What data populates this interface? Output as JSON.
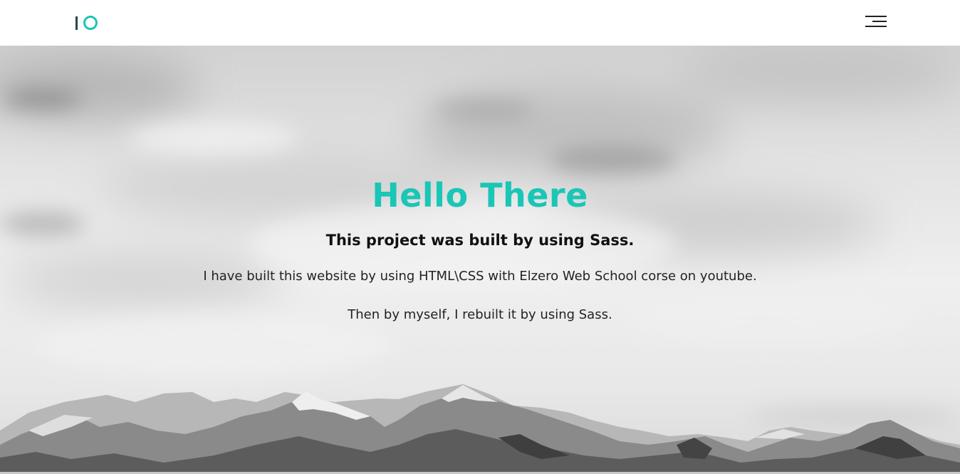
{
  "header": {
    "logo": {
      "icon": "io-logo-icon",
      "bar_color": "#1f4954",
      "ring_color": "#1ac6b6"
    },
    "menu_icon": "hamburger-menu-icon"
  },
  "hero": {
    "background": "grayscale-sky-with-mountains",
    "title": "Hello There",
    "title_color": "#1ac6b6",
    "subtitle": "This project was built by using Sass.",
    "paragraphs": [
      "I have built this website by using HTML\\CSS with Elzero Web School corse on youtube.",
      "Then by myself, I rebuilt it by using Sass."
    ]
  }
}
